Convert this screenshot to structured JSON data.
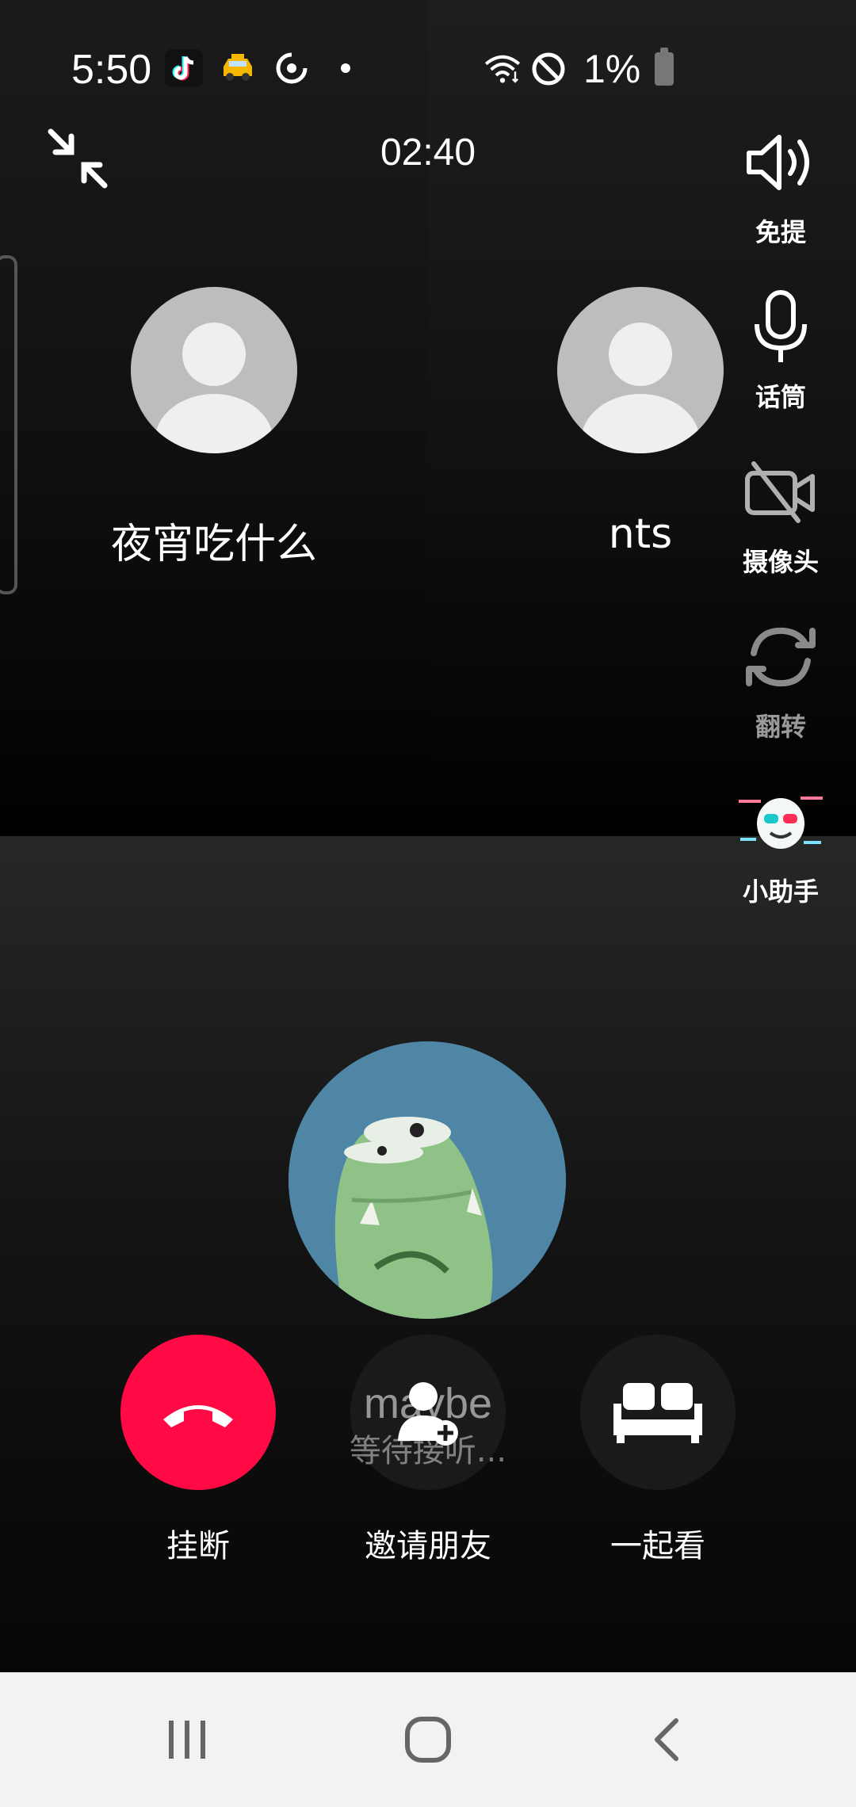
{
  "status_bar": {
    "time": "5:50",
    "battery": "1%",
    "icons": [
      "tiktok-icon",
      "taxi-icon",
      "sync-icon",
      "dot-icon",
      "wifi-icon",
      "do-not-disturb-icon",
      "battery-icon"
    ]
  },
  "call": {
    "timer": "02:40"
  },
  "participants": [
    {
      "name": "夜宵吃什么"
    },
    {
      "name": "nts"
    }
  ],
  "controls": {
    "speaker": "免提",
    "microphone": "话筒",
    "camera": "摄像头",
    "flip": "翻转",
    "assistant": "小助手"
  },
  "pending": {
    "name": "maybe",
    "status": "等待接听..."
  },
  "actions": {
    "hangup": "挂断",
    "invite": "邀请朋友",
    "watch_together": "一起看"
  },
  "colors": {
    "hangup": "#ff0a45",
    "nav_bar": "#f2f2f2",
    "self_avatar_bg": "#4f86a6"
  },
  "nav": [
    "recent-apps-icon",
    "home-icon",
    "back-icon"
  ]
}
